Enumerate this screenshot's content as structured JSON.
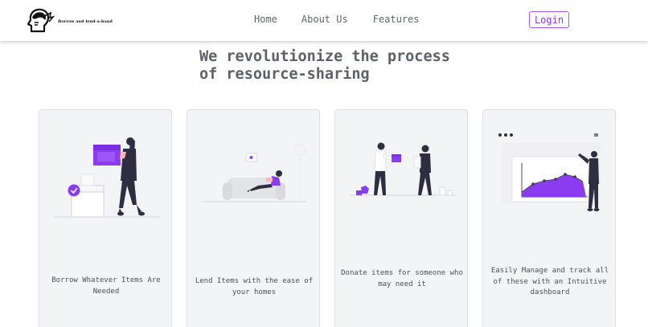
{
  "navbar": {
    "brand": "Borrow and lend-a-hand",
    "links": [
      {
        "label": "Home"
      },
      {
        "label": "About Us"
      },
      {
        "label": "Features"
      }
    ],
    "login_label": "Login"
  },
  "hero": {
    "title": "We revolutionize the process of resource-sharing"
  },
  "features": [
    {
      "text": "Borrow Whatever Items Are Needed",
      "illustration": "person-carrying-box-illustration"
    },
    {
      "text": "Lend Items with the ease of your homes",
      "illustration": "person-relaxing-on-couch-illustration"
    },
    {
      "text": "Donate items for someone who may need it",
      "illustration": "people-handing-box-illustration"
    },
    {
      "text": "Easily Manage and track all of these with an Intuitive dashboard",
      "illustration": "person-viewing-chart-illustration"
    }
  ],
  "colors": {
    "accent": "#a855f7",
    "accent_dark": "#9333ea",
    "illustration_purple": "#8b3cf0",
    "card_bg": "#f3f4f6",
    "figure_dark": "#2f2e41",
    "text": "#555a61"
  }
}
